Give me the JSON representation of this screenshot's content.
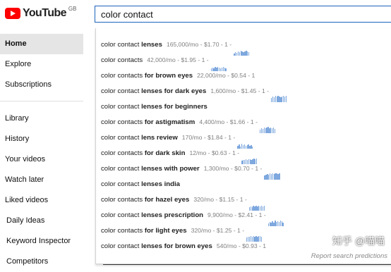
{
  "logo": {
    "wordmark": "YouTube",
    "region": "GB"
  },
  "search": {
    "value": "color contact"
  },
  "sidebar": {
    "primary": [
      "Home",
      "Explore",
      "Subscriptions"
    ],
    "library": [
      "Library",
      "History",
      "Your videos",
      "Watch later",
      "Liked videos"
    ],
    "extras": [
      "Daily Ideas",
      "Keyword Inspector",
      "Competitors"
    ]
  },
  "suggestions": [
    {
      "base": "color contact ",
      "ext": "lenses",
      "meta": "165,000/mo - $1.70 - 1 -",
      "trend": [
        3,
        5,
        4,
        6,
        5,
        7,
        6,
        5,
        6,
        7,
        6,
        5
      ]
    },
    {
      "base": "color contacts",
      "ext": "",
      "meta": "42,000/mo - $1.95 - 1 -",
      "trend": [
        4,
        5,
        4,
        6,
        5,
        6,
        5,
        4,
        5,
        6,
        5,
        4
      ]
    },
    {
      "base": "color contacts ",
      "ext": "for brown eyes",
      "meta": "22,000/mo - $0.54 - 1",
      "trend": []
    },
    {
      "base": "color contact ",
      "ext": "lenses for dark eyes",
      "meta": "1,600/mo - $1.45 - 1 -",
      "trend": [
        6,
        8,
        7,
        9,
        8,
        9,
        8,
        7,
        8,
        9,
        8,
        9
      ]
    },
    {
      "base": "color contact ",
      "ext": "lenses for beginners",
      "meta": "",
      "trend": []
    },
    {
      "base": "color contacts ",
      "ext": "for astigmatism",
      "meta": "4,400/mo - $1.66 - 1 -",
      "trend": [
        5,
        7,
        6,
        8,
        7,
        8,
        9,
        7,
        8,
        7,
        8,
        6
      ]
    },
    {
      "base": "color contact ",
      "ext": "lens review",
      "meta": "170/mo - $1.84 - 1 -",
      "trend": [
        4,
        6,
        3,
        7,
        5,
        6,
        4,
        5,
        6,
        4,
        5,
        3
      ]
    },
    {
      "base": "color contacts ",
      "ext": "for dark skin",
      "meta": "12/mo - $0.63 - 1 -",
      "trend": [
        5,
        6,
        6,
        7,
        6,
        7,
        7,
        6,
        7,
        8,
        7,
        8
      ]
    },
    {
      "base": "color contact ",
      "ext": "lenses with power",
      "meta": "1,300/mo - $0.70 - 1 -",
      "trend": [
        6,
        7,
        8,
        7,
        9,
        8,
        9,
        8,
        9,
        9,
        8,
        9
      ]
    },
    {
      "base": "color contact ",
      "ext": "lenses india",
      "meta": "",
      "trend": []
    },
    {
      "base": "color contacts ",
      "ext": "for hazel eyes",
      "meta": "320/mo - $1.15 - 1 -",
      "trend": [
        5,
        6,
        5,
        7,
        6,
        7,
        6,
        7,
        6,
        7,
        6,
        7
      ]
    },
    {
      "base": "color contact ",
      "ext": "lenses prescription",
      "meta": "9,900/mo - $2.41 - 1 -",
      "trend": [
        4,
        6,
        5,
        7,
        5,
        8,
        6,
        7,
        6,
        8,
        7,
        5
      ]
    },
    {
      "base": "color contacts ",
      "ext": "for light eyes",
      "meta": "320/mo - $1.25 - 1 -",
      "trend": [
        6,
        7,
        7,
        8,
        7,
        8,
        7,
        8,
        7,
        8,
        8,
        7
      ]
    },
    {
      "base": "color contact ",
      "ext": "lenses for brown eyes",
      "meta": "540/mo - $0.93 - 1",
      "trend": []
    }
  ],
  "watermark": "知乎 @喵喵",
  "report_link": "Report search predictions",
  "colors": {
    "logo_red": "#ff0000",
    "search_border": "#1c62b9",
    "trend_bar": "#7ea8de",
    "active_nav": "#e5e5e5"
  }
}
